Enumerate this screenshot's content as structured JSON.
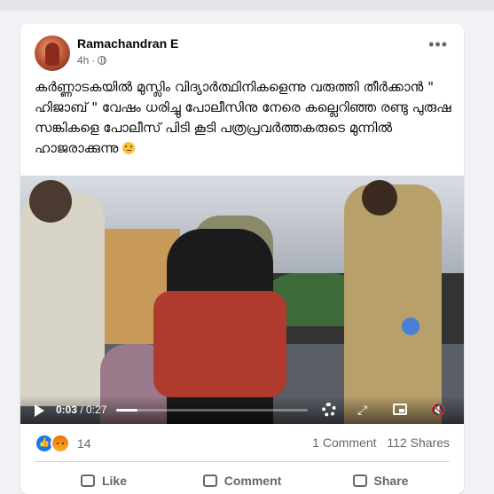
{
  "post": {
    "author": "Ramachandran E",
    "time": "4h",
    "privacy_icon": "globe-icon",
    "more_icon": "more-options-icon",
    "text": "കർണ്ണാടകയിൽ മുസ്ലിം വിദ്യാർത്ഥിനികളെന്നു വരുത്തി തീർക്കാൻ \" ഹിജാബ് \" വേഷം ധരിച്ചു പോലീസിനു നേരെ കല്ലെറിഞ്ഞ രണ്ടു പുരുഷ സങ്കികളെ പോലീസ് പിടി കൂടി പത്രപ്രവർത്തകരുടെ മുന്നിൽ ഹാജരാക്കുന്നു",
    "emoji": "thinking-face-emoji"
  },
  "video": {
    "current_time": "0:03",
    "duration": "/ 0:27",
    "progress": 0.11
  },
  "engagement": {
    "reaction_count": "14",
    "comments": "1 Comment",
    "shares": "112 Shares"
  },
  "actions": {
    "like": "Like",
    "comment": "Comment",
    "share": "Share"
  },
  "colors": {
    "accent": "#1877f2",
    "text_primary": "#050505",
    "text_secondary": "#65676b",
    "background": "#f0f2f5"
  }
}
